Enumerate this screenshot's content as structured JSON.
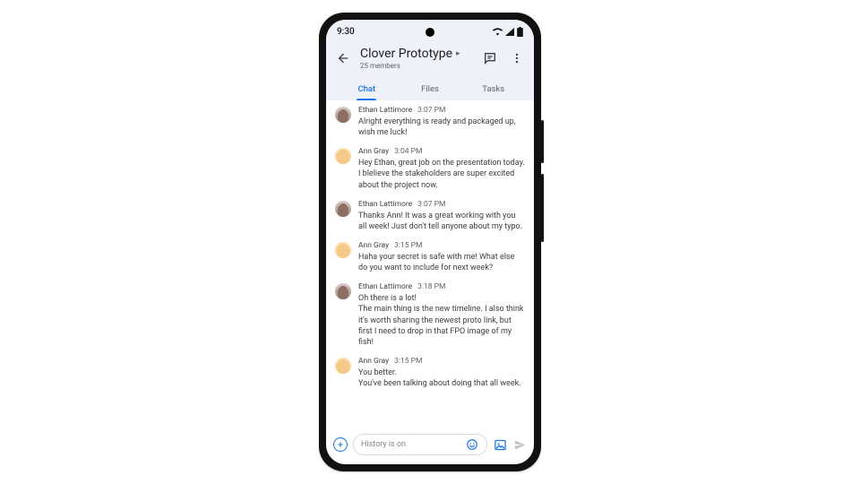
{
  "status": {
    "time": "9:30"
  },
  "header": {
    "title": "Clover Prototype",
    "subtitle": "25 members"
  },
  "tabs": [
    {
      "label": "Chat",
      "active": true
    },
    {
      "label": "Files",
      "active": false
    },
    {
      "label": "Tasks",
      "active": false
    }
  ],
  "messages": [
    {
      "author": "Ethan Lattimore",
      "avatar": "ethan",
      "time": "3:07 PM",
      "lines": [
        "Alright everything is ready and packaged up, wish me luck!"
      ]
    },
    {
      "author": "Ann Gray",
      "avatar": "ann",
      "time": "3:04 PM",
      "lines": [
        "Hey Ethan, great job on the presentation today. I blelieve the stakeholders are super excited about the project now."
      ]
    },
    {
      "author": "Ethan Lattimore",
      "avatar": "ethan",
      "time": "3:07 PM",
      "lines": [
        "Thanks Ann! It was a great working with you all week! Just don't tell anyone about my typo."
      ]
    },
    {
      "author": "Ann Gray",
      "avatar": "ann",
      "time": "3:15 PM",
      "lines": [
        "Haha your secret is safe with me!  What else do you want to include for next week?"
      ]
    },
    {
      "author": "Ethan Lattimore",
      "avatar": "ethan",
      "time": "3:18 PM",
      "lines": [
        "Oh there is a lot!",
        "The main thing is the new timeline. I also think it's worth sharing the newest proto link, but first I need to drop in that FPO image of my fish!"
      ]
    },
    {
      "author": "Ann Gray",
      "avatar": "ann",
      "time": "3:15 PM",
      "lines": [
        "You better.",
        "You've been talking about doing that all week."
      ]
    }
  ],
  "composer": {
    "placeholder": "History is on"
  }
}
